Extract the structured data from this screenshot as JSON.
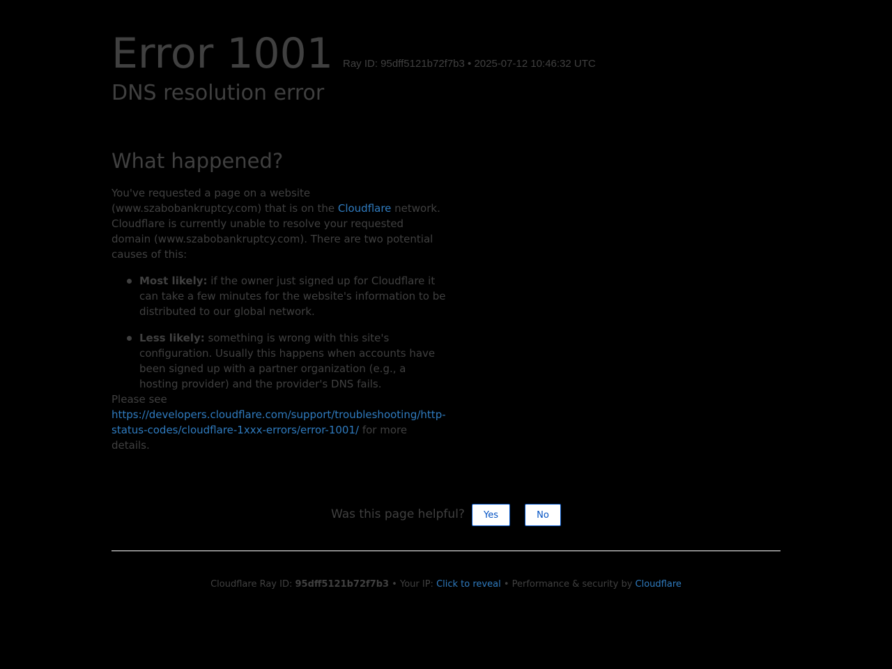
{
  "header": {
    "error_code": "Error 1001",
    "ray_line": "Ray ID: 95dff5121b72f7b3 • 2025-07-12 10:46:32 UTC",
    "error_title": "DNS resolution error"
  },
  "what_happened": {
    "heading": "What happened?",
    "intro_part1": "You've requested a page on a website (www.szabobankruptcy.com) that is on the ",
    "intro_link": "Cloudflare",
    "intro_part2": " network. Cloudflare is currently unable to resolve your requested domain (www.szabobankruptcy.com). There are two potential causes of this:",
    "causes": [
      {
        "label": "Most likely:",
        "text": " if the owner just signed up for Cloudflare it can take a few minutes for the website's information to be distributed to our global network."
      },
      {
        "label": "Less likely:",
        "text": " something is wrong with this site's configuration. Usually this happens when accounts have been signed up with a partner organization (e.g., a hosting provider) and the provider's DNS fails."
      }
    ],
    "see_prefix": "Please see ",
    "see_link": "https://developers.cloudflare.com/support/troubleshooting/http-status-codes/cloudflare-1xxx-errors/error-1001/",
    "see_suffix": " for more details."
  },
  "feedback": {
    "question": "Was this page helpful?",
    "yes_label": "Yes",
    "no_label": "No"
  },
  "footer": {
    "ray_prefix": "Cloudflare Ray ID: ",
    "ray_id": "95dff5121b72f7b3",
    "sep1": " • ",
    "ip_prefix": "Your IP: ",
    "ip_link": "Click to reveal",
    "sep2": " • ",
    "perf_prefix": "Performance & security by ",
    "perf_link": "Cloudflare"
  },
  "colors": {
    "background": "#000000",
    "text": "#404040",
    "link": "#2f7bbf",
    "button_border": "#0051c3"
  }
}
